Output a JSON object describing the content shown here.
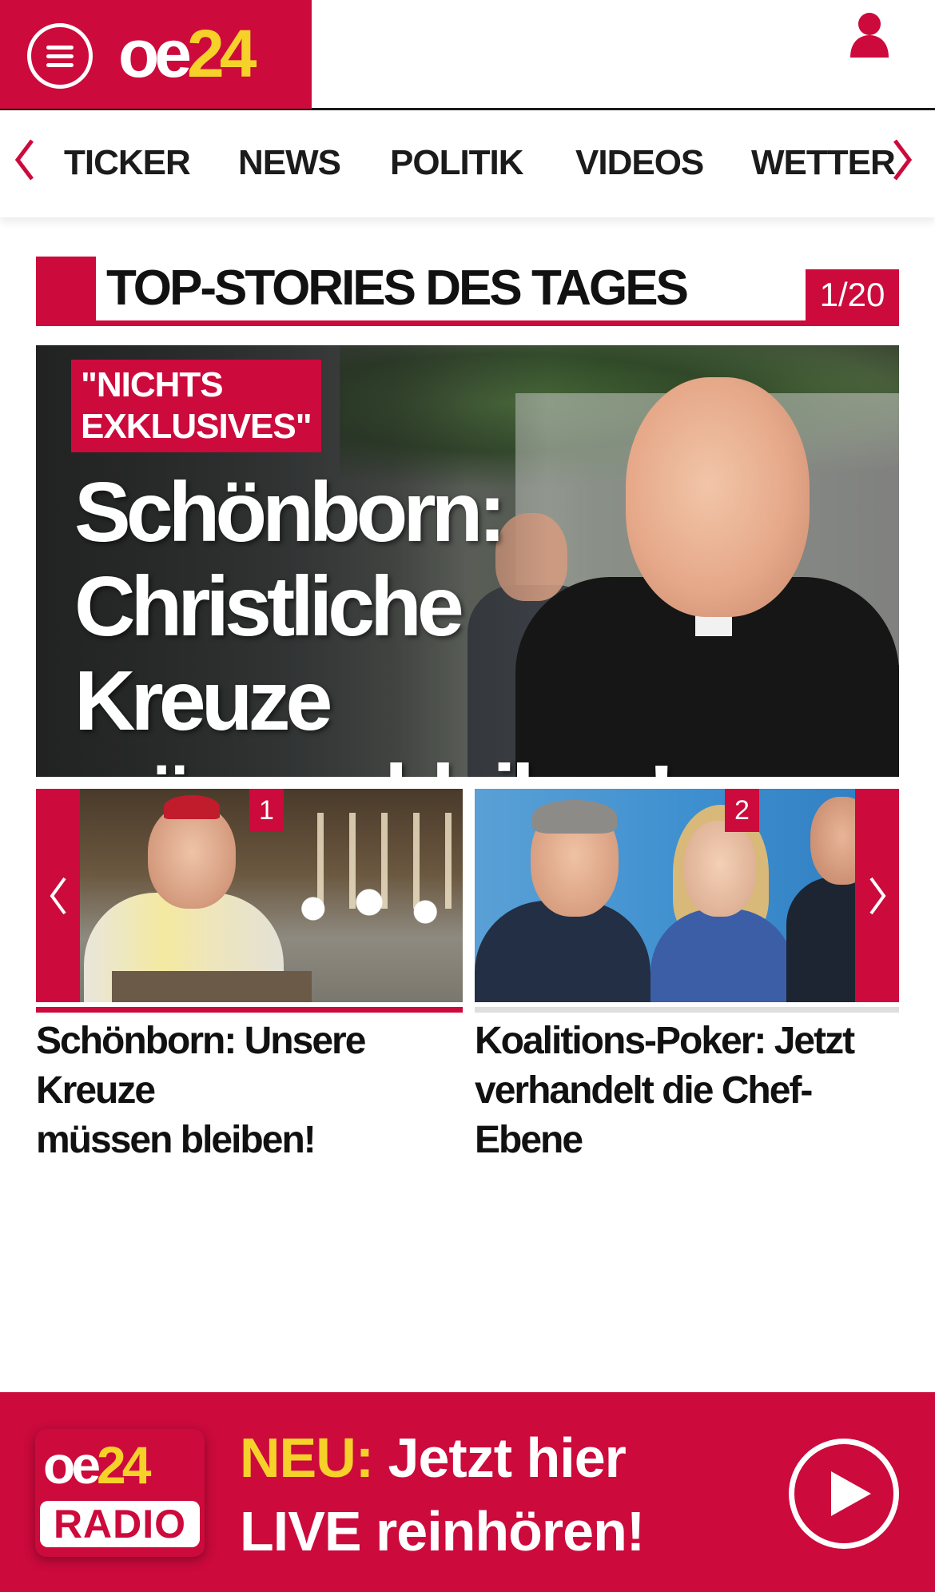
{
  "header": {
    "logo_oe": "oe",
    "logo_24": "24",
    "menu_icon": "hamburger-menu-icon",
    "user_icon": "user-icon"
  },
  "nav": {
    "items": [
      "TICKER",
      "NEWS",
      "POLITIK",
      "VIDEOS",
      "WETTER"
    ]
  },
  "section": {
    "title": "TOP-STORIES DES TAGES",
    "counter": "1/20"
  },
  "hero": {
    "kicker_line1": "\"NICHTS",
    "kicker_line2": "EXKLUSIVES\"",
    "headline_line1": "Schönborn:",
    "headline_line2": "Christliche Kreuze",
    "headline_line3": "müssen bleiben!"
  },
  "teasers": [
    {
      "number": "1",
      "title_line1": "Schönborn: Unsere Kreuze",
      "title_line2": "müssen bleiben!"
    },
    {
      "number": "2",
      "title_line1": "Koalitions-Poker: Jetzt",
      "title_line2": "verhandelt die Chef-Ebene"
    }
  ],
  "radio": {
    "logo_oe": "oe",
    "logo_24": "24",
    "logo_radio": "RADIO",
    "neu": "NEU:",
    "line1_rest": " Jetzt hier",
    "line2": "LIVE reinhören!"
  },
  "colors": {
    "brand_red": "#cc0a3c",
    "brand_yellow": "#f6d12a"
  }
}
